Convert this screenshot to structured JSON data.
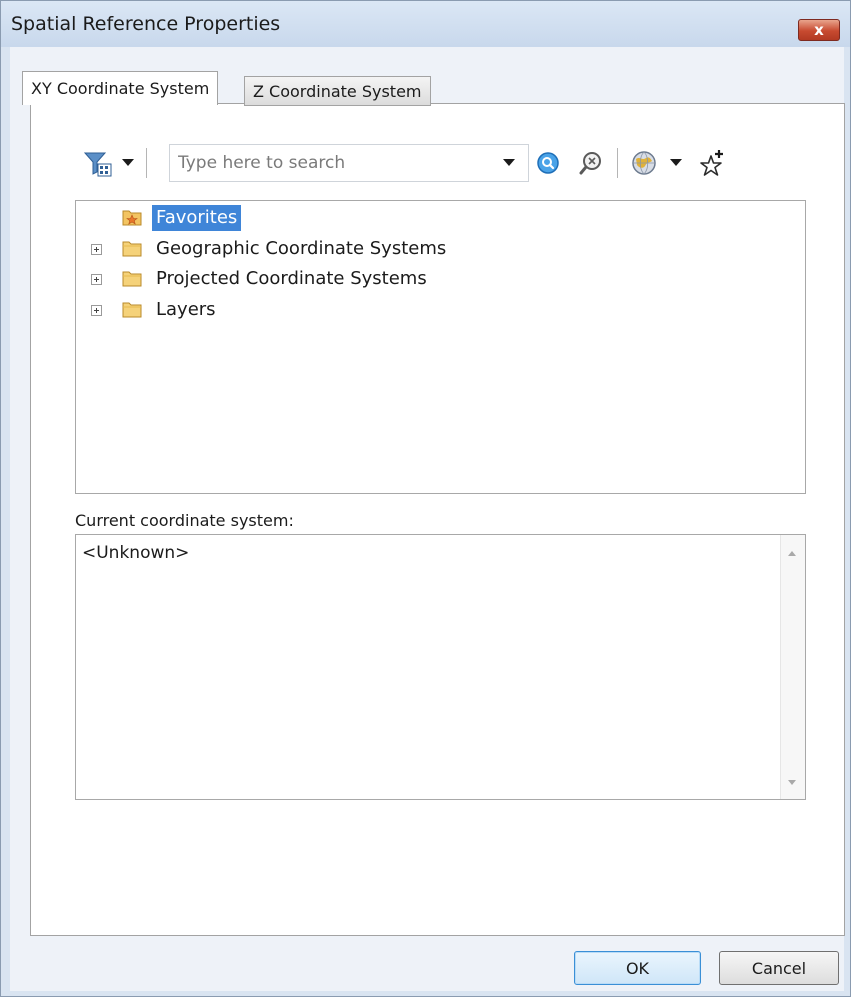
{
  "window": {
    "title": "Spatial Reference Properties",
    "close_label": "x"
  },
  "tabs": [
    {
      "label": "XY Coordinate System",
      "active": true
    },
    {
      "label": "Z Coordinate System",
      "active": false
    }
  ],
  "toolbar": {
    "filter_icon": "filter-icon",
    "search": {
      "value": "",
      "placeholder": "Type here to search"
    },
    "icons": [
      "search-icon",
      "search-clear-icon",
      "globe-icon",
      "favorite-star-icon"
    ]
  },
  "tree": {
    "items": [
      {
        "label": "Favorites",
        "icon": "favorites-folder-icon",
        "expandable": false,
        "selected": true
      },
      {
        "label": "Geographic Coordinate Systems",
        "icon": "folder-icon",
        "expandable": true,
        "selected": false
      },
      {
        "label": "Projected Coordinate Systems",
        "icon": "folder-icon",
        "expandable": true,
        "selected": false
      },
      {
        "label": "Layers",
        "icon": "folder-icon",
        "expandable": true,
        "selected": false
      }
    ]
  },
  "current": {
    "label": "Current coordinate system:",
    "value": "<Unknown>"
  },
  "buttons": {
    "ok": "OK",
    "cancel": "Cancel"
  },
  "colors": {
    "selection": "#3f85d8",
    "titlebar": "#c8d8ec",
    "close_button": "#c74a30"
  }
}
